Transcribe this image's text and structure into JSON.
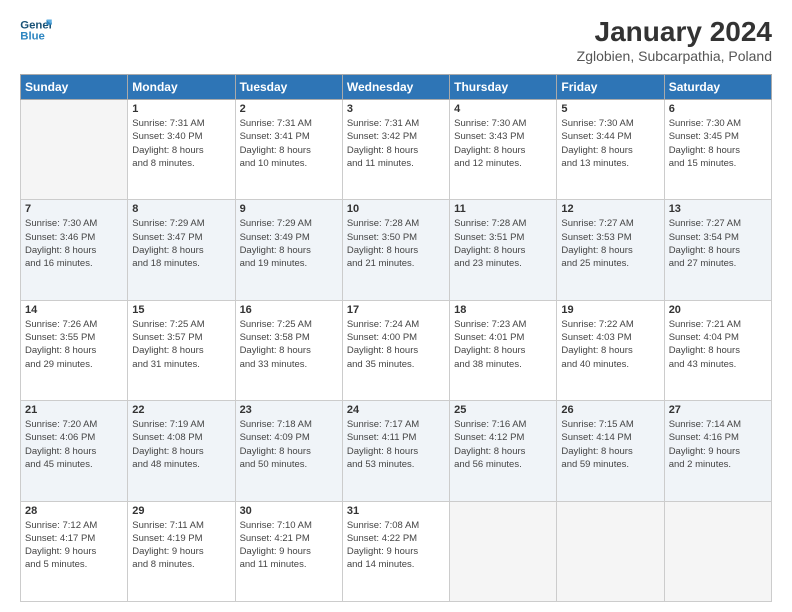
{
  "header": {
    "logo_line1": "General",
    "logo_line2": "Blue",
    "main_title": "January 2024",
    "subtitle": "Zglobien, Subcarpathia, Poland"
  },
  "calendar": {
    "days_of_week": [
      "Sunday",
      "Monday",
      "Tuesday",
      "Wednesday",
      "Thursday",
      "Friday",
      "Saturday"
    ],
    "weeks": [
      [
        {
          "day": "",
          "info": ""
        },
        {
          "day": "1",
          "info": "Sunrise: 7:31 AM\nSunset: 3:40 PM\nDaylight: 8 hours\nand 8 minutes."
        },
        {
          "day": "2",
          "info": "Sunrise: 7:31 AM\nSunset: 3:41 PM\nDaylight: 8 hours\nand 10 minutes."
        },
        {
          "day": "3",
          "info": "Sunrise: 7:31 AM\nSunset: 3:42 PM\nDaylight: 8 hours\nand 11 minutes."
        },
        {
          "day": "4",
          "info": "Sunrise: 7:30 AM\nSunset: 3:43 PM\nDaylight: 8 hours\nand 12 minutes."
        },
        {
          "day": "5",
          "info": "Sunrise: 7:30 AM\nSunset: 3:44 PM\nDaylight: 8 hours\nand 13 minutes."
        },
        {
          "day": "6",
          "info": "Sunrise: 7:30 AM\nSunset: 3:45 PM\nDaylight: 8 hours\nand 15 minutes."
        }
      ],
      [
        {
          "day": "7",
          "info": "Sunrise: 7:30 AM\nSunset: 3:46 PM\nDaylight: 8 hours\nand 16 minutes."
        },
        {
          "day": "8",
          "info": "Sunrise: 7:29 AM\nSunset: 3:47 PM\nDaylight: 8 hours\nand 18 minutes."
        },
        {
          "day": "9",
          "info": "Sunrise: 7:29 AM\nSunset: 3:49 PM\nDaylight: 8 hours\nand 19 minutes."
        },
        {
          "day": "10",
          "info": "Sunrise: 7:28 AM\nSunset: 3:50 PM\nDaylight: 8 hours\nand 21 minutes."
        },
        {
          "day": "11",
          "info": "Sunrise: 7:28 AM\nSunset: 3:51 PM\nDaylight: 8 hours\nand 23 minutes."
        },
        {
          "day": "12",
          "info": "Sunrise: 7:27 AM\nSunset: 3:53 PM\nDaylight: 8 hours\nand 25 minutes."
        },
        {
          "day": "13",
          "info": "Sunrise: 7:27 AM\nSunset: 3:54 PM\nDaylight: 8 hours\nand 27 minutes."
        }
      ],
      [
        {
          "day": "14",
          "info": "Sunrise: 7:26 AM\nSunset: 3:55 PM\nDaylight: 8 hours\nand 29 minutes."
        },
        {
          "day": "15",
          "info": "Sunrise: 7:25 AM\nSunset: 3:57 PM\nDaylight: 8 hours\nand 31 minutes."
        },
        {
          "day": "16",
          "info": "Sunrise: 7:25 AM\nSunset: 3:58 PM\nDaylight: 8 hours\nand 33 minutes."
        },
        {
          "day": "17",
          "info": "Sunrise: 7:24 AM\nSunset: 4:00 PM\nDaylight: 8 hours\nand 35 minutes."
        },
        {
          "day": "18",
          "info": "Sunrise: 7:23 AM\nSunset: 4:01 PM\nDaylight: 8 hours\nand 38 minutes."
        },
        {
          "day": "19",
          "info": "Sunrise: 7:22 AM\nSunset: 4:03 PM\nDaylight: 8 hours\nand 40 minutes."
        },
        {
          "day": "20",
          "info": "Sunrise: 7:21 AM\nSunset: 4:04 PM\nDaylight: 8 hours\nand 43 minutes."
        }
      ],
      [
        {
          "day": "21",
          "info": "Sunrise: 7:20 AM\nSunset: 4:06 PM\nDaylight: 8 hours\nand 45 minutes."
        },
        {
          "day": "22",
          "info": "Sunrise: 7:19 AM\nSunset: 4:08 PM\nDaylight: 8 hours\nand 48 minutes."
        },
        {
          "day": "23",
          "info": "Sunrise: 7:18 AM\nSunset: 4:09 PM\nDaylight: 8 hours\nand 50 minutes."
        },
        {
          "day": "24",
          "info": "Sunrise: 7:17 AM\nSunset: 4:11 PM\nDaylight: 8 hours\nand 53 minutes."
        },
        {
          "day": "25",
          "info": "Sunrise: 7:16 AM\nSunset: 4:12 PM\nDaylight: 8 hours\nand 56 minutes."
        },
        {
          "day": "26",
          "info": "Sunrise: 7:15 AM\nSunset: 4:14 PM\nDaylight: 8 hours\nand 59 minutes."
        },
        {
          "day": "27",
          "info": "Sunrise: 7:14 AM\nSunset: 4:16 PM\nDaylight: 9 hours\nand 2 minutes."
        }
      ],
      [
        {
          "day": "28",
          "info": "Sunrise: 7:12 AM\nSunset: 4:17 PM\nDaylight: 9 hours\nand 5 minutes."
        },
        {
          "day": "29",
          "info": "Sunrise: 7:11 AM\nSunset: 4:19 PM\nDaylight: 9 hours\nand 8 minutes."
        },
        {
          "day": "30",
          "info": "Sunrise: 7:10 AM\nSunset: 4:21 PM\nDaylight: 9 hours\nand 11 minutes."
        },
        {
          "day": "31",
          "info": "Sunrise: 7:08 AM\nSunset: 4:22 PM\nDaylight: 9 hours\nand 14 minutes."
        },
        {
          "day": "",
          "info": ""
        },
        {
          "day": "",
          "info": ""
        },
        {
          "day": "",
          "info": ""
        }
      ]
    ]
  }
}
